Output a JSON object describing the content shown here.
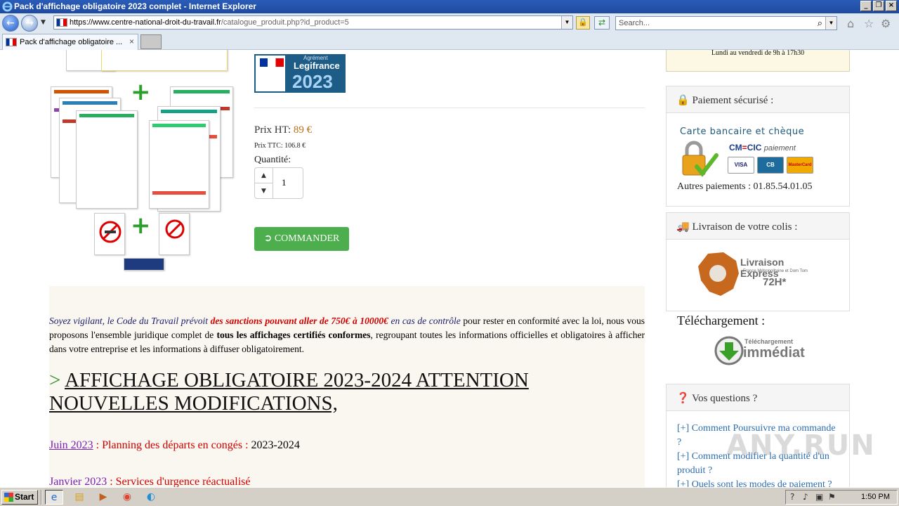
{
  "window": {
    "title": "Pack d'affichage obligatoire 2023 complet - Internet Explorer"
  },
  "nav": {
    "url_host": "https://www.centre-national-droit-du-travail.fr",
    "url_path": "/catalogue_produit.php?id_product=5",
    "search_placeholder": "Search..."
  },
  "tabs": [
    {
      "label": "Pack d'affichage obligatoire ...",
      "close": "×"
    }
  ],
  "product": {
    "legifrance_agrement": "Agrément",
    "legifrance_brand": "Legifrance",
    "legifrance_year": "2023",
    "price_ht_label": "Prix HT:",
    "price_ht_value": "89 €",
    "price_ttc": "Prix TTC: 106.8 €",
    "qty_label": "Quantité:",
    "qty_value": "1",
    "order_button": "COMMANDER"
  },
  "description": {
    "p1": "Soyez vigilant, le Code du Travail prévoit ",
    "p2": "des sanctions pouvant aller de 750€ à 10000€",
    "p3": " en cas de contrôle",
    "p4": " pour rester en conformité avec la loi, nous vous proposons l'ensemble juridique complet de ",
    "p5": "tous les affichages certifiés conformes",
    "p6": ", regroupant toutes les informations officielles et obligatoires à afficher dans votre entreprise et les informations à diffuser obligatoirement.",
    "heading_marker": ">",
    "heading": "AFFICHAGE OBLIGATOIRE 2023-2024 ATTENTION NOUVELLES MODIFICATIONS,",
    "updates": [
      {
        "date": "Juin 2023",
        "colon": " : ",
        "what": "Planning des départs en congés",
        "sep": " : ",
        "extra": "2023-2024"
      },
      {
        "date": "Janvier 2023",
        "colon": " : ",
        "what": "Services d'urgence réactualisé",
        "sep": "",
        "extra": ""
      }
    ]
  },
  "sidebar": {
    "hours": "Lundi au vendredi de 9h à 17h30",
    "payment_title": "Paiement sécurisé :",
    "payment_methods": "Carte bancaire et chèque",
    "cm_cic": "CM",
    "cm_cic2": "CIC",
    "paiement": "paiement",
    "card_visa": "VISA",
    "card_cb": "CB",
    "card_mc": "MasterCard",
    "other_payments": "Autres paiements : 01.85.54.01.05",
    "delivery_title": "Livraison de votre colis :",
    "delivery_express": "Livraison Express",
    "delivery_zone": "France Métropolitaine et Dom Tom",
    "delivery_time": "72H*",
    "download_title": "Téléchargement :",
    "download_badge_top": "Téléchargement",
    "download_badge": "immédiat",
    "questions_title": "Vos questions ?",
    "faq": [
      "[+] Comment Poursuivre ma commande ?",
      "[+] Comment modifier la quantité d'un produit ?",
      "[+] Quels sont les modes de paiement ?"
    ]
  },
  "watermark": "ANY.RUN",
  "taskbar": {
    "start": "Start",
    "time": "1:50 PM"
  },
  "colors": {
    "accent_green": "#4cae4c",
    "price_orange": "#b86f12",
    "sanction_red": "#d00000",
    "legifrance_blue": "#1e5c88"
  }
}
